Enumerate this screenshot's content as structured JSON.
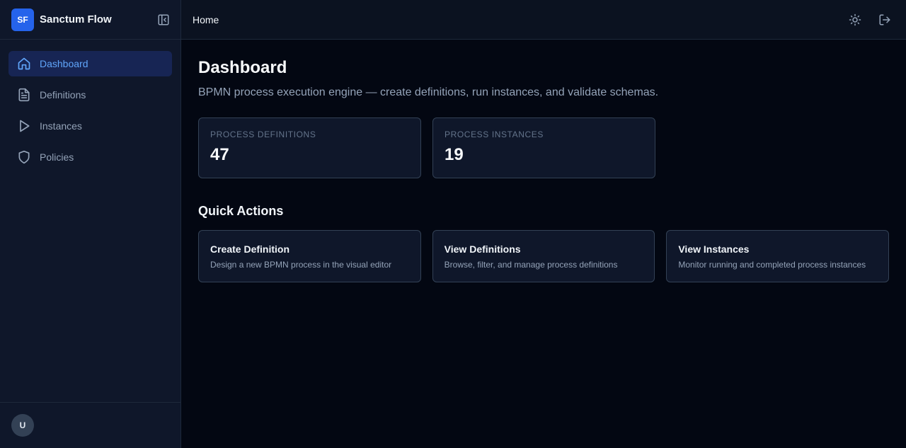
{
  "app": {
    "logo_text": "SF",
    "name": "Sanctum Flow"
  },
  "sidebar": {
    "items": [
      {
        "label": "Dashboard",
        "icon": "home-icon",
        "active": true
      },
      {
        "label": "Definitions",
        "icon": "file-text-icon"
      },
      {
        "label": "Instances",
        "icon": "play-icon"
      },
      {
        "label": "Policies",
        "icon": "shield-icon"
      }
    ],
    "user_initial": "U"
  },
  "topbar": {
    "breadcrumb": "Home"
  },
  "page": {
    "title": "Dashboard",
    "subtitle": "BPMN process execution engine — create definitions, run instances, and validate schemas."
  },
  "stats": [
    {
      "label": "Process Definitions",
      "value": "47"
    },
    {
      "label": "Process Instances",
      "value": "19"
    }
  ],
  "quick_actions": {
    "title": "Quick Actions",
    "items": [
      {
        "title": "Create Definition",
        "description": "Design a new BPMN process in the visual editor"
      },
      {
        "title": "View Definitions",
        "description": "Browse, filter, and manage process definitions"
      },
      {
        "title": "View Instances",
        "description": "Monitor running and completed process instances"
      }
    ]
  },
  "colors": {
    "accent": "#2563eb",
    "active_text": "#60a5fa",
    "background": "#030712",
    "sidebar": "#0f172a"
  }
}
